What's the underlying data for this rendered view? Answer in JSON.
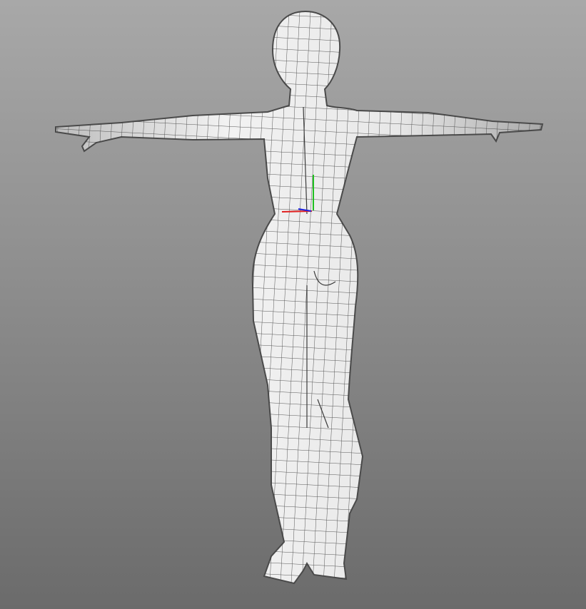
{
  "viewport": {
    "background_top": "#a8a8a8",
    "background_bottom": "#6b6b6b",
    "mesh_fill": "#e6e6e6",
    "mesh_wire": "#3a3a3a"
  },
  "gizmo": {
    "x_axis_color": "#e02020",
    "y_axis_color": "#20c020",
    "z_axis_color": "#2020e0"
  }
}
